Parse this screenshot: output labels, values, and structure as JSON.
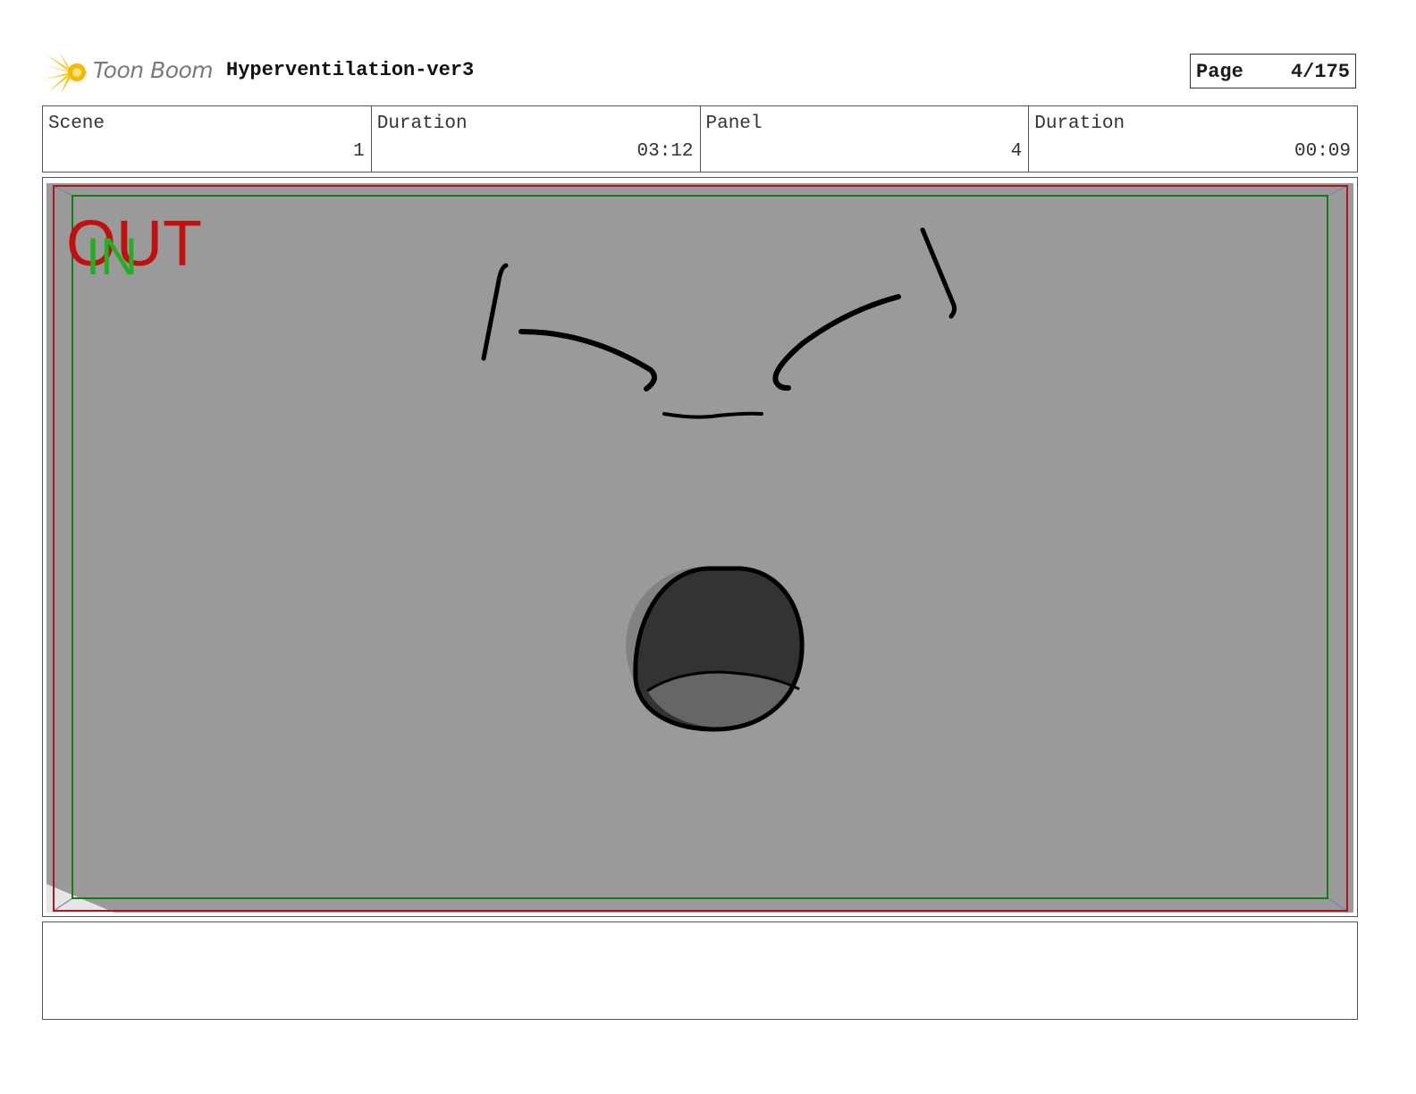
{
  "header": {
    "logo_text": "Toon Boom",
    "project_title": "Hyperventilation-ver3",
    "page_label": "Page",
    "page_value": "4/175"
  },
  "info": {
    "scene_label": "Scene",
    "scene_value": "1",
    "scene_duration_label": "Duration",
    "scene_duration_value": "03:12",
    "panel_label": "Panel",
    "panel_value": "4",
    "panel_duration_label": "Duration",
    "panel_duration_value": "00:09"
  },
  "panel": {
    "out_label": "OUT",
    "in_label": "IN",
    "colors": {
      "background": "#9a9a9a",
      "out_frame": "#b0141e",
      "in_frame": "#137a1a",
      "out_text": "#c01010",
      "in_text": "#22b022",
      "ink": "#000000",
      "mouth_fill": "#333333",
      "tongue_fill": "#666666"
    }
  },
  "notes": {
    "text": ""
  }
}
